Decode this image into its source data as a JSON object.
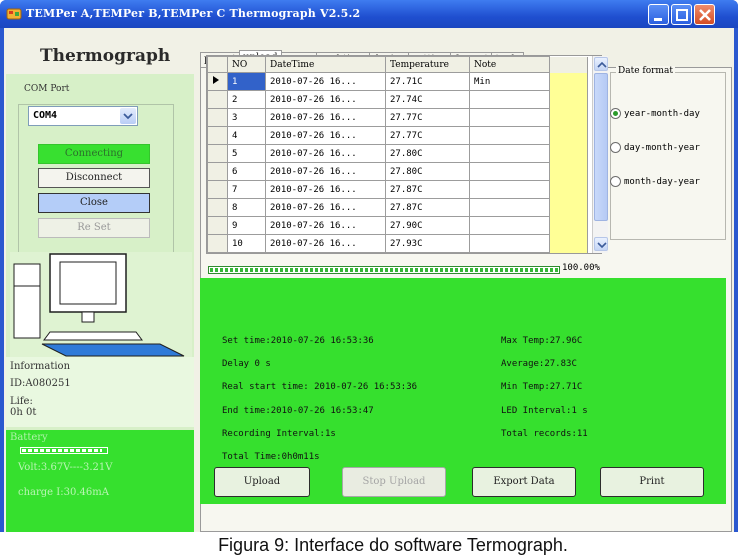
{
  "window": {
    "title": "TEMPer A,TEMPer B,TEMPer C Thermograph V2.5.2"
  },
  "app_title": "Thermograph",
  "com_port": {
    "label": "COM Port",
    "value": "COM4"
  },
  "left_buttons": {
    "connecting": "Connecting",
    "disconnect": "Disconnect",
    "close": "Close",
    "reset": "Re Set"
  },
  "information": {
    "title": "Information",
    "id": "ID:A080251",
    "life_label": "Life:",
    "life_value": "0h 0t"
  },
  "battery": {
    "title": "Battery",
    "level": 0.95,
    "voltage": "Volt:3.67V----3.21V",
    "charge": "charge I:30.46mA"
  },
  "tabs": [
    "preset",
    "upload",
    "curve",
    "real time",
    "device",
    "setting",
    "format",
    "tools"
  ],
  "active_tab": "upload",
  "grid": {
    "columns": [
      "NO",
      "DateTime",
      "Temperature",
      "Note"
    ],
    "rows": [
      [
        "1",
        "2010-07-26  16...",
        "27.71C",
        "Min"
      ],
      [
        "2",
        "2010-07-26  16...",
        "27.74C",
        ""
      ],
      [
        "3",
        "2010-07-26  16...",
        "27.77C",
        ""
      ],
      [
        "4",
        "2010-07-26  16...",
        "27.77C",
        ""
      ],
      [
        "5",
        "2010-07-26  16...",
        "27.80C",
        ""
      ],
      [
        "6",
        "2010-07-26  16...",
        "27.80C",
        ""
      ],
      [
        "7",
        "2010-07-26  16...",
        "27.87C",
        ""
      ],
      [
        "8",
        "2010-07-26  16...",
        "27.87C",
        ""
      ],
      [
        "9",
        "2010-07-26  16...",
        "27.90C",
        ""
      ],
      [
        "10",
        "2010-07-26  16...",
        "27.93C",
        ""
      ]
    ],
    "selected_row": 0
  },
  "date_format": {
    "title": "Date format",
    "options": [
      "year-month-day",
      "day-month-year",
      "month-day-year"
    ],
    "selected": 0
  },
  "progress": {
    "value": 1.0,
    "text": "100.00%"
  },
  "summary": {
    "set_time": "Set time:2010-07-26  16:53:36",
    "delay": "Delay 0 s",
    "real_start": "Real start time: 2010-07-26  16:53:36",
    "end_time": "End time:2010-07-26  16:53:47",
    "recording_interval": "Recording Interval:1s",
    "total_time": "Total Time:0h0m11s",
    "max_temp": "Max Temp:27.96C",
    "average": "Average:27.83C",
    "min_temp": "Min Temp:27.71C",
    "led_interval": "LED Interval:1 s",
    "total_records": "Total records:11"
  },
  "bottom_buttons": {
    "upload": "Upload",
    "stop_upload": "Stop Upload",
    "export": "Export Data",
    "print": "Print"
  },
  "caption": "Figura 9: Interface do software Termograph."
}
